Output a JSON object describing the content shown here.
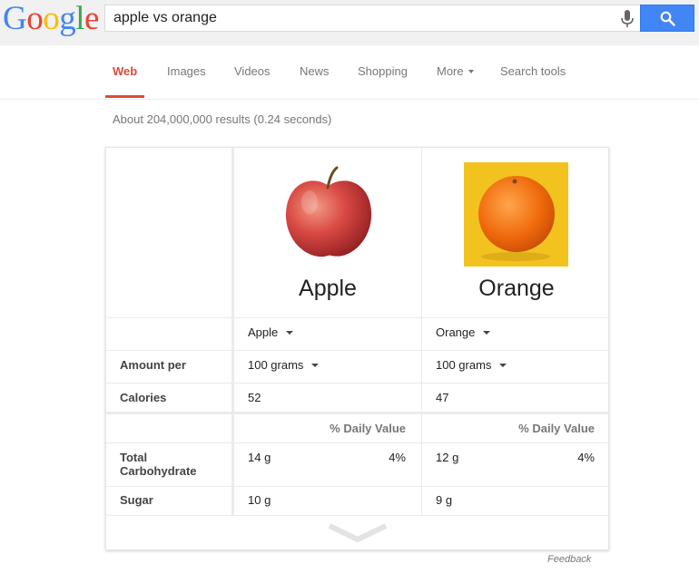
{
  "logo": {
    "letters": [
      "G",
      "o",
      "o",
      "g",
      "l",
      "e"
    ],
    "colors": [
      "#4285f4",
      "#ea4335",
      "#fbbc05",
      "#4285f4",
      "#34a853",
      "#ea4335"
    ]
  },
  "search": {
    "query": "apple vs orange"
  },
  "tabs": [
    {
      "label": "Web",
      "active": true
    },
    {
      "label": "Images"
    },
    {
      "label": "Videos"
    },
    {
      "label": "News"
    },
    {
      "label": "Shopping"
    },
    {
      "label": "More"
    },
    {
      "label": "Search tools"
    }
  ],
  "result_stats": "About 204,000,000 results (0.24 seconds)",
  "comparison": {
    "fruits": [
      {
        "name": "Apple",
        "selector": "Apple",
        "amount": "100 grams",
        "calories": "52",
        "carbs": "14 g",
        "carbs_pct": "4%",
        "sugar": "10 g"
      },
      {
        "name": "Orange",
        "selector": "Orange",
        "amount": "100 grams",
        "calories": "47",
        "carbs": "12 g",
        "carbs_pct": "4%",
        "sugar": "9 g"
      }
    ],
    "row_labels": {
      "amount": "Amount per",
      "calories": "Calories",
      "carbs": "Total Carbohydrate",
      "sugar": "Sugar"
    },
    "daily_value_header": "% Daily Value"
  },
  "feedback": "Feedback",
  "accent_colors": {
    "search_button": "#4285f4",
    "active_tab": "#dd4b39"
  }
}
